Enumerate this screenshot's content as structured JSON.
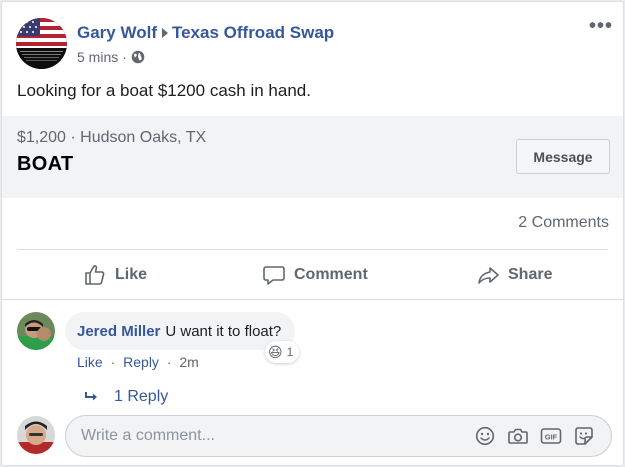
{
  "post": {
    "author": "Gary Wolf",
    "group": "Texas Offroad Swap",
    "time": "5 mins",
    "meta_separator": "·",
    "more_label": "•••",
    "text": "Looking for a boat $1200 cash in hand."
  },
  "listing": {
    "price": "$1,200",
    "separator": "·",
    "location": "Hudson Oaks, TX",
    "title": "BOAT",
    "message_label": "Message"
  },
  "stats": {
    "comments_count": "2 Comments"
  },
  "actions": {
    "like": "Like",
    "comment": "Comment",
    "share": "Share"
  },
  "comment": {
    "author": "Jered Miller",
    "text": "U want it to float?",
    "reaction_emoji": "😆",
    "reaction_count": "1",
    "like_label": "Like",
    "reply_label": "Reply",
    "time": "2m",
    "separator": "·",
    "replies_label": "1 Reply"
  },
  "composer": {
    "placeholder": "Write a comment..."
  },
  "colors": {
    "link": "#365899",
    "secondary_text": "#606770",
    "listing_bg": "#f2f3f5",
    "card_bg": "#ffffff"
  },
  "icons": {
    "globe": "globe-icon",
    "like": "thumbs-up-icon",
    "comment": "speech-bubble-icon",
    "share": "share-arrow-icon",
    "reply": "reply-arrow-icon",
    "emoji": "smiley-icon",
    "camera": "camera-icon",
    "gif": "gif-icon",
    "sticker": "sticker-icon"
  }
}
